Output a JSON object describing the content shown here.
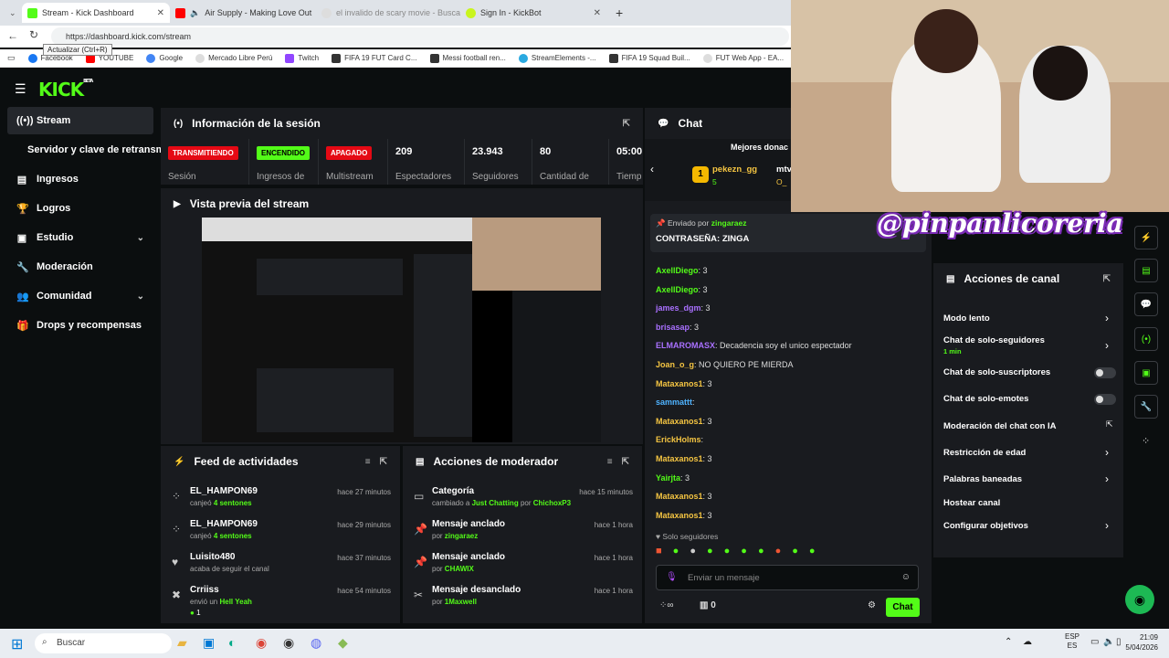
{
  "browser": {
    "tabs": [
      {
        "title": "Stream - Kick Dashboard",
        "active": true
      },
      {
        "title": "Air Supply - Making Love Out",
        "active": false
      },
      {
        "title": "el invalido de scary movie - Busca",
        "active": false
      },
      {
        "title": "Sign In - KickBot",
        "active": false
      }
    ],
    "url": "https://dashboard.kick.com/stream",
    "tooltip": "Actualizar (Ctrl+R)",
    "bookmarks": [
      "Facebook",
      "YOUTUBE",
      "Google",
      "Mercado Libre Perú",
      "Twitch",
      "FIFA 19 FUT Card C...",
      "Messi football ren...",
      "StreamElements -...",
      "FIFA 19 Squad Buil...",
      "FUT Web App - EA..."
    ]
  },
  "app": {
    "logo": "KICK",
    "logo_beta": "BETA",
    "sidebar": [
      {
        "label": "Stream",
        "icon": "broadcast-icon",
        "active": true
      },
      {
        "label": "Servidor y clave de retransmisión",
        "icon": "",
        "active": false
      },
      {
        "label": "Ingresos",
        "icon": "chart-icon",
        "active": false
      },
      {
        "label": "Logros",
        "icon": "trophy-icon",
        "active": false
      },
      {
        "label": "Estudio",
        "icon": "layout-icon",
        "active": false,
        "expandable": true
      },
      {
        "label": "Moderación",
        "icon": "wrench-icon",
        "active": false
      },
      {
        "label": "Comunidad",
        "icon": "users-icon",
        "active": false,
        "expandable": true
      },
      {
        "label": "Drops y recompensas",
        "icon": "gift-icon",
        "active": false
      }
    ],
    "session": {
      "title": "Información de la sesión",
      "stats": [
        {
          "badge": "TRANSMITIENDO",
          "badge_color": "#e50914",
          "label": "Sesión"
        },
        {
          "badge": "ENCENDIDO",
          "badge_color": "#53fc18",
          "label": "Ingresos de"
        },
        {
          "badge": "APAGADO",
          "badge_color": "#e50914",
          "label": "Multistream"
        },
        {
          "value": "209",
          "label": "Espectadores"
        },
        {
          "value": "23.943",
          "label": "Seguidores"
        },
        {
          "value": "80",
          "label": "Cantidad de"
        },
        {
          "value": "05:00",
          "label": "Tiemp"
        }
      ]
    },
    "preview": {
      "title": "Vista previa del stream"
    },
    "feed": {
      "title": "Feed de actividades",
      "items": [
        {
          "name": "EL_HAMPON69",
          "prefix": "canjeó",
          "highlight": "4 sentones",
          "suffix": "",
          "time": "hace 27 minutos",
          "icon": "redeem-icon"
        },
        {
          "name": "EL_HAMPON69",
          "prefix": "canjeó",
          "highlight": "4 sentones",
          "suffix": "",
          "time": "hace 29 minutos",
          "icon": "redeem-icon"
        },
        {
          "name": "Luisito480",
          "prefix": "acaba de seguir el canal",
          "highlight": "",
          "suffix": "",
          "time": "hace 37 minutos",
          "icon": "heart-icon"
        },
        {
          "name": "Crriiss",
          "prefix": "envió un",
          "highlight": "Hell Yeah",
          "suffix": "1",
          "time": "hace 54 minutos",
          "icon": "kick-icon"
        }
      ]
    },
    "mod_actions": {
      "title": "Acciones de moderador",
      "items": [
        {
          "name": "Categoría",
          "line": "cambiado a",
          "highlight": "Just Chatting",
          "by": "por",
          "user": "ChichoxP3",
          "time": "hace 15 minutos",
          "icon": "category-icon"
        },
        {
          "name": "Mensaje anclado",
          "line": "",
          "highlight": "",
          "by": "por",
          "user": "zingaraez",
          "time": "hace 1 hora",
          "icon": "pin-icon"
        },
        {
          "name": "Mensaje anclado",
          "line": "",
          "highlight": "",
          "by": "por",
          "user": "CHAWIX",
          "time": "hace 1 hora",
          "icon": "pin-icon"
        },
        {
          "name": "Mensaje desanclado",
          "line": "",
          "highlight": "",
          "by": "por",
          "user": "1Maxwell",
          "time": "hace 1 hora",
          "icon": "unpin-icon"
        }
      ]
    },
    "chat": {
      "title": "Chat",
      "top_donors_title": "Mejores donac",
      "donor_rank": "1",
      "donor_name": "pekezn_gg",
      "donor_amount": "5",
      "donor2": "mtv",
      "donor2_amount": "O_",
      "pinned_by_label": "Enviado por",
      "pinned_user": "zingaraez",
      "pinned_text": "CONTRASEÑA: ZINGA",
      "messages": [
        {
          "user": "AxellDiego",
          "color": "#53fc18",
          "text": "3"
        },
        {
          "user": "AxellDiego",
          "color": "#53fc18",
          "text": "3"
        },
        {
          "user": "james_dgm",
          "color": "#a970ff",
          "text": "3"
        },
        {
          "user": "brisasap",
          "color": "#a970ff",
          "text": "3"
        },
        {
          "user": "ELMAROMASX",
          "color": "#a970ff",
          "text": "Decadencia soy el unico espectador"
        },
        {
          "user": "Joan_o_g",
          "color": "#f5c542",
          "text": "NO QUIERO PE MIERDA"
        },
        {
          "user": "Mataxanos1",
          "color": "#f5c542",
          "text": "3"
        },
        {
          "user": "sammattt",
          "color": "#4fb3ff",
          "text": ""
        },
        {
          "user": "Mataxanos1",
          "color": "#f5c542",
          "text": "3"
        },
        {
          "user": "ErickHolms",
          "color": "#f5c542",
          "text": ""
        },
        {
          "user": "Mataxanos1",
          "color": "#f5c542",
          "text": "3"
        },
        {
          "user": "Yairjta",
          "color": "#53fc18",
          "text": "3"
        },
        {
          "user": "Mataxanos1",
          "color": "#f5c542",
          "text": "3"
        },
        {
          "user": "Mataxanos1",
          "color": "#f5c542",
          "text": "3"
        }
      ],
      "followers_only": "Solo seguidores",
      "input_placeholder": "Enviar un mensaje",
      "viewer_count": "0",
      "send_label": "Chat"
    },
    "channel_actions": {
      "title": "Acciones de canal",
      "items": [
        {
          "label": "Modo lento",
          "control": "arrow",
          "sub": ""
        },
        {
          "label": "Chat de solo-seguidores",
          "control": "arrow",
          "sub": "1 min"
        },
        {
          "label": "Chat de solo-suscriptores",
          "control": "toggle",
          "sub": ""
        },
        {
          "label": "Chat de solo-emotes",
          "control": "toggle",
          "sub": ""
        },
        {
          "label": "Moderación del chat con IA",
          "control": "external",
          "sub": ""
        },
        {
          "label": "Restricción de edad",
          "control": "arrow",
          "sub": ""
        },
        {
          "label": "Palabras baneadas",
          "control": "arrow",
          "sub": ""
        },
        {
          "label": "Hostear canal",
          "control": "",
          "sub": ""
        },
        {
          "label": "Configurar objetivos",
          "control": "arrow",
          "sub": ""
        }
      ]
    },
    "overlay_text": "@pinpanlicoreria"
  },
  "taskbar": {
    "search_placeholder": "Buscar",
    "lang_top": "ESP",
    "lang_bottom": "ES",
    "time": "21:09",
    "date": "5/04/2026"
  }
}
